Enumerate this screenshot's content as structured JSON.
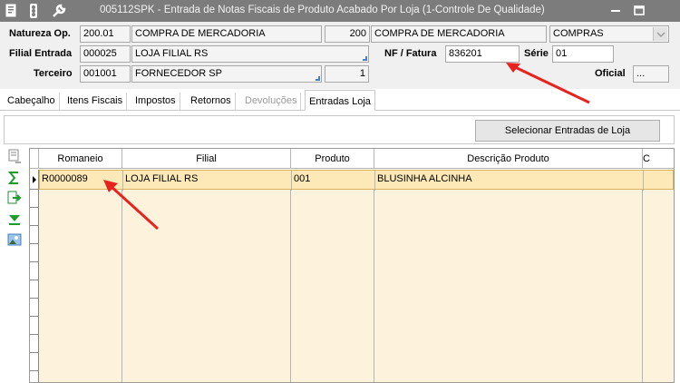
{
  "window": {
    "title": "005112SPK - Entrada de Notas Fiscais de Produto Acabado Por Loja (1-Controle De Qualidade)",
    "icons": [
      "document-icon",
      "traffic-light-icon",
      "wrench-icon"
    ],
    "controls": [
      "minimize-icon",
      "restore-icon"
    ]
  },
  "header": {
    "natureza": {
      "label": "Natureza Op.",
      "code": "200.01",
      "desc": "COMPRA DE MERCADORIA",
      "num": "200",
      "desc2": "COMPRA DE MERCADORIA",
      "combo": "COMPRAS"
    },
    "filial": {
      "label": "Filial Entrada",
      "code": "000025",
      "desc": "LOJA FILIAL RS"
    },
    "terceiro": {
      "label": "Terceiro",
      "code": "001001",
      "desc": "FORNECEDOR SP",
      "num": "1"
    },
    "nf": {
      "label": "NF / Fatura",
      "value": "836201"
    },
    "serie": {
      "label": "Série",
      "value": "01"
    },
    "oficial": {
      "label": "Oficial",
      "value": "..."
    }
  },
  "tabs": [
    {
      "label": "Cabeçalho",
      "state": "normal"
    },
    {
      "label": "Itens Fiscais",
      "state": "normal"
    },
    {
      "label": "Impostos",
      "state": "normal"
    },
    {
      "label": "Retornos",
      "state": "normal"
    },
    {
      "label": "Devoluções",
      "state": "disabled"
    },
    {
      "label": "Entradas Loja",
      "state": "active"
    }
  ],
  "panel": {
    "button_label": "Selecionar Entradas de Loja"
  },
  "grid": {
    "columns": [
      "Romaneio",
      "Filial",
      "Produto",
      "Descrição Produto",
      "C"
    ],
    "rows": [
      {
        "romaneio": "R0000089",
        "filial": "LOJA FILIAL RS",
        "produto": "001",
        "descricao": "BLUSINHA ALCINHA"
      }
    ]
  },
  "sidebar_icons": [
    "grid-settings-icon",
    "sum-icon",
    "export-icon",
    "filter-down-icon",
    "image-icon"
  ],
  "colors": {
    "titlebar": "#7c7c7c",
    "selected_row": "#fde9b8",
    "annotation_arrow": "#e8231f"
  }
}
